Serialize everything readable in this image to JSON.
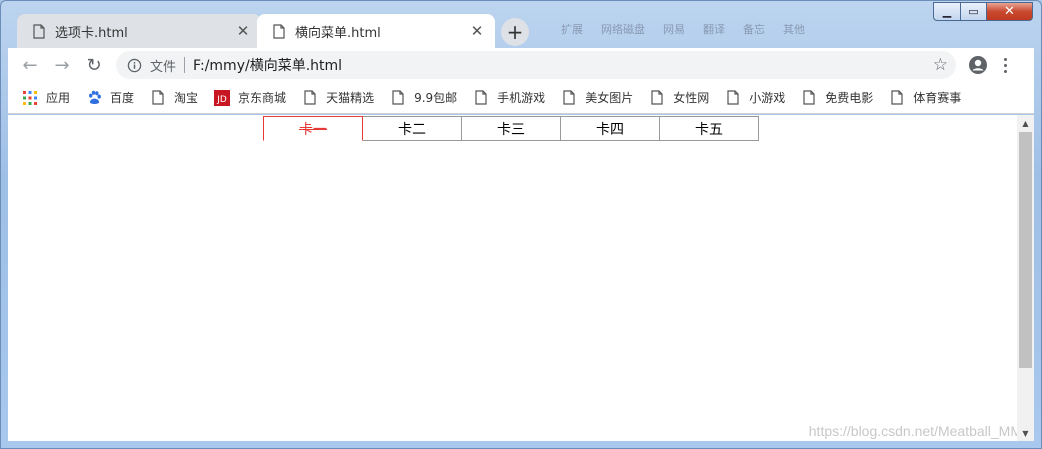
{
  "window": {
    "minimize_glyph": "▁",
    "maximize_glyph": "▭",
    "close_glyph": "✕",
    "background_blur_items": [
      "扩展",
      "网络磁盘",
      "网易",
      "翻译",
      "备忘",
      "其他"
    ]
  },
  "tabs": [
    {
      "title": "选项卡.html",
      "icon": "document-icon",
      "close": "✕",
      "active": false
    },
    {
      "title": "横向菜单.html",
      "icon": "document-icon",
      "close": "✕",
      "active": true
    }
  ],
  "new_tab_label": "+",
  "toolbar": {
    "back_glyph": "←",
    "forward_glyph": "→",
    "reload_glyph": "↻",
    "scheme_label": "文件",
    "url": "F:/mmy/横向菜单.html",
    "star_glyph": "☆"
  },
  "bookmarks": [
    {
      "label": "应用",
      "icon": "apps-grid-icon"
    },
    {
      "label": "百度",
      "icon": "baidu-paw-icon"
    },
    {
      "label": "淘宝",
      "icon": "document-icon"
    },
    {
      "label": "京东商城",
      "icon": "jd-logo-icon"
    },
    {
      "label": "天猫精选",
      "icon": "document-icon"
    },
    {
      "label": "9.9包邮",
      "icon": "document-icon"
    },
    {
      "label": "手机游戏",
      "icon": "document-icon"
    },
    {
      "label": "美女图片",
      "icon": "document-icon"
    },
    {
      "label": "女性网",
      "icon": "document-icon"
    },
    {
      "label": "小游戏",
      "icon": "document-icon"
    },
    {
      "label": "免费电影",
      "icon": "document-icon"
    },
    {
      "label": "体育赛事",
      "icon": "document-icon"
    }
  ],
  "page": {
    "menu_tabs": [
      "卡一",
      "卡二",
      "卡三",
      "卡四",
      "卡五"
    ],
    "selected_index": 0,
    "watermark": "https://blog.csdn.net/Meatball_MM"
  },
  "colors": {
    "selected_tab": "#e53935",
    "tab_border": "#999999",
    "chrome_tab_inactive": "#dee1e6"
  }
}
